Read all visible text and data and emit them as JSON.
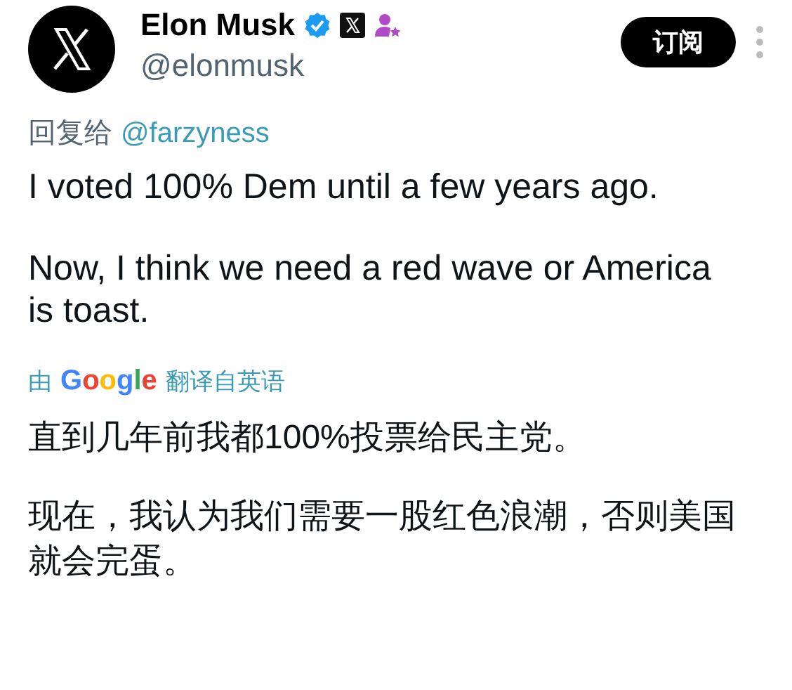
{
  "author": {
    "name": "Elon Musk",
    "handle": "@elonmusk",
    "verified": true
  },
  "subscribe_button": "订阅",
  "reply_to": {
    "prefix": "回复给",
    "mention": "@farzyness"
  },
  "tweet_paragraphs": [
    "I voted 100% Dem until a few years ago.",
    "Now, I think we need a red wave or America is toast."
  ],
  "translation_note": {
    "prefix": "由",
    "provider": "Google",
    "suffix": "翻译自英语"
  },
  "translated_paragraphs": [
    "直到几年前我都100%投票给民主党。",
    "现在，我认为我们需要一股红色浪潮，否则美国就会完蛋。"
  ]
}
